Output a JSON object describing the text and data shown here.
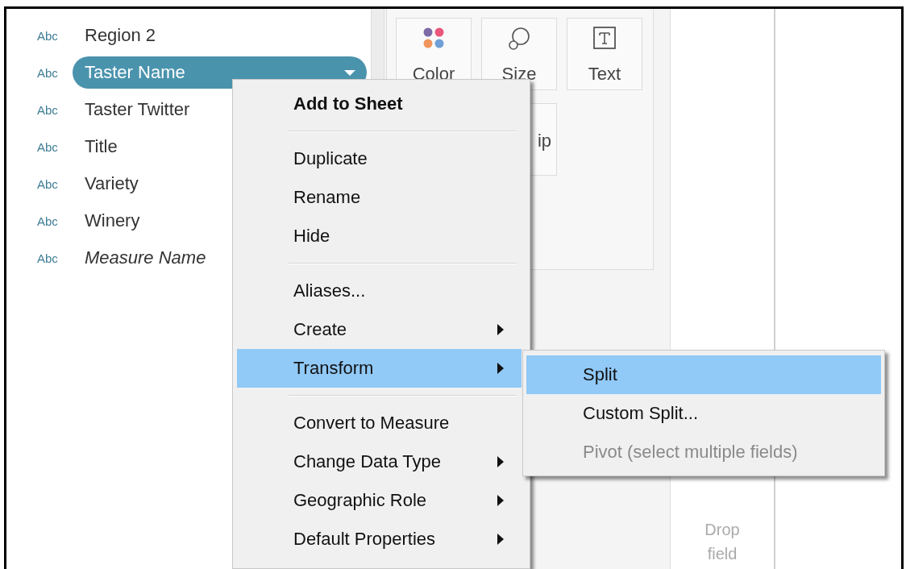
{
  "fields": [
    {
      "badge": "Abc",
      "name": "Region 2",
      "selected": false,
      "italic": false
    },
    {
      "badge": "Abc",
      "name": "Taster Name",
      "selected": true,
      "italic": false
    },
    {
      "badge": "Abc",
      "name": "Taster Twitter",
      "selected": false,
      "italic": false
    },
    {
      "badge": "Abc",
      "name": "Title",
      "selected": false,
      "italic": false
    },
    {
      "badge": "Abc",
      "name": "Variety",
      "selected": false,
      "italic": false
    },
    {
      "badge": "Abc",
      "name": "Winery",
      "selected": false,
      "italic": false
    },
    {
      "badge": "Abc",
      "name": "Measure Name",
      "selected": false,
      "italic": true
    }
  ],
  "marks_cards": [
    {
      "kind": "color",
      "label": "Color"
    },
    {
      "kind": "size",
      "label": "Size"
    },
    {
      "kind": "text",
      "label": "Text"
    },
    {
      "kind": "tooltip",
      "label": "ip"
    }
  ],
  "drop_hint": "Drop field",
  "context_menu": [
    {
      "kind": "item",
      "label": "Add to Sheet",
      "bold": true,
      "submenu": false,
      "selected": false
    },
    {
      "kind": "separator"
    },
    {
      "kind": "item",
      "label": "Duplicate",
      "bold": false,
      "submenu": false,
      "selected": false
    },
    {
      "kind": "item",
      "label": "Rename",
      "bold": false,
      "submenu": false,
      "selected": false
    },
    {
      "kind": "item",
      "label": "Hide",
      "bold": false,
      "submenu": false,
      "selected": false
    },
    {
      "kind": "separator"
    },
    {
      "kind": "item",
      "label": "Aliases...",
      "bold": false,
      "submenu": false,
      "selected": false
    },
    {
      "kind": "item",
      "label": "Create",
      "bold": false,
      "submenu": true,
      "selected": false
    },
    {
      "kind": "item",
      "label": "Transform",
      "bold": false,
      "submenu": true,
      "selected": true
    },
    {
      "kind": "separator"
    },
    {
      "kind": "item",
      "label": "Convert to Measure",
      "bold": false,
      "submenu": false,
      "selected": false
    },
    {
      "kind": "item",
      "label": "Change Data Type",
      "bold": false,
      "submenu": true,
      "selected": false
    },
    {
      "kind": "item",
      "label": "Geographic Role",
      "bold": false,
      "submenu": true,
      "selected": false
    },
    {
      "kind": "item",
      "label": "Default Properties",
      "bold": false,
      "submenu": true,
      "selected": false
    }
  ],
  "submenu": [
    {
      "label": "Split",
      "selected": true,
      "disabled": false
    },
    {
      "label": "Custom Split...",
      "selected": false,
      "disabled": false
    },
    {
      "label": "Pivot (select multiple fields)",
      "selected": false,
      "disabled": true
    }
  ]
}
